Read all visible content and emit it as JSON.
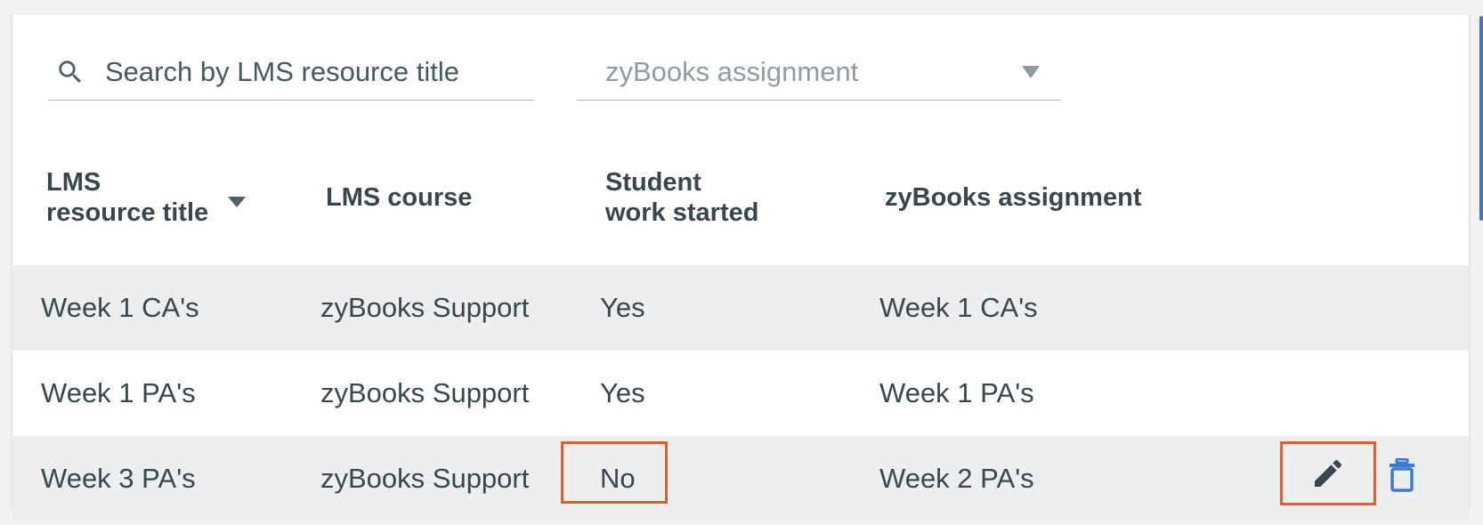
{
  "filters": {
    "search_placeholder": "Search by LMS resource title",
    "assignment_select_value": "zyBooks assignment"
  },
  "table": {
    "columns": [
      {
        "line1": "LMS",
        "line2": "resource title"
      },
      {
        "line1": "LMS course",
        "line2": ""
      },
      {
        "line1": "Student",
        "line2": "work started"
      },
      {
        "line1": "zyBooks assignment",
        "line2": ""
      }
    ],
    "rows": [
      {
        "resource_title": "Week 1 CA's",
        "course": "zyBooks Support",
        "work_started": "Yes",
        "assignment": "Week 1 CA's"
      },
      {
        "resource_title": "Week 1 PA's",
        "course": "zyBooks Support",
        "work_started": "Yes",
        "assignment": "Week 1 PA's"
      },
      {
        "resource_title": "Week 3 PA's",
        "course": "zyBooks Support",
        "work_started": "No",
        "assignment": "Week 2 PA's"
      }
    ]
  },
  "colors": {
    "highlight": "#e05b2e",
    "delete_icon": "#3a7bd5",
    "row_shade": "#eceef0"
  },
  "icons": [
    "search-icon",
    "dropdown-caret-icon",
    "sort-caret-icon",
    "pencil-icon",
    "trash-icon"
  ]
}
